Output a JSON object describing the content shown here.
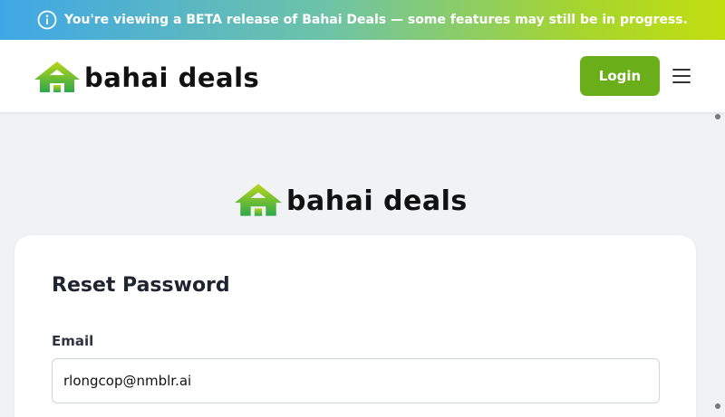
{
  "banner": {
    "icon": "info-icon",
    "text": "You're viewing a BETA release of Bahai Deals — some features may still be in progress."
  },
  "header": {
    "logo_text": "bahai deals",
    "login_label": "Login",
    "menu_icon": "hamburger-menu-icon"
  },
  "main": {
    "logo_text": "bahai deals",
    "card": {
      "title": "Reset Password",
      "email_label": "Email",
      "email_value": "rlongcop@nmblr.ai"
    }
  },
  "colors": {
    "brand_green": "#6aae1a",
    "banner_gradient_start": "#3fa7e6",
    "banner_gradient_end": "#c2de0f"
  }
}
